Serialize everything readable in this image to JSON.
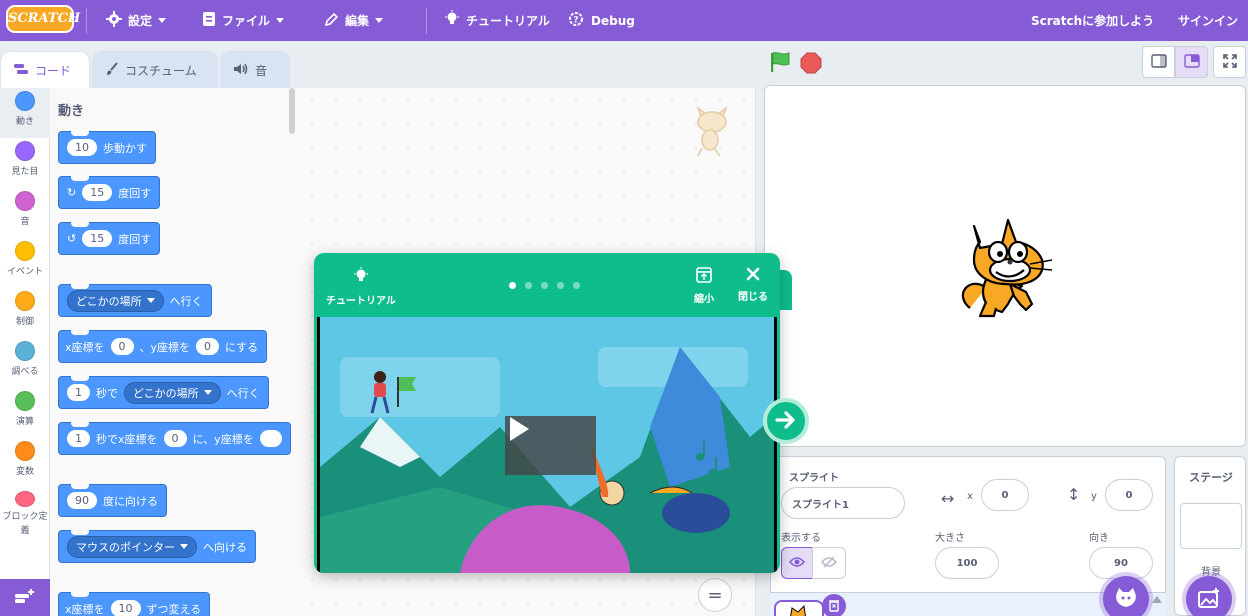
{
  "menubar": {
    "logo_text": "SCRATCH",
    "settings_label": "設定",
    "file_label": "ファイル",
    "edit_label": "編集",
    "tutorials_label": "チュートリアル",
    "debug_label": "Debug",
    "join_label": "Scratchに参加しよう",
    "signin_label": "サインイン"
  },
  "tabs": [
    {
      "label": "コード",
      "icon": "code-icon",
      "active": true
    },
    {
      "label": "コスチューム",
      "icon": "brush-icon",
      "active": false
    },
    {
      "label": "音",
      "icon": "speaker-icon",
      "active": false
    }
  ],
  "categories": [
    {
      "label": "動き",
      "color": "#4c97ff"
    },
    {
      "label": "見た目",
      "color": "#9966ff"
    },
    {
      "label": "音",
      "color": "#cf63cf"
    },
    {
      "label": "イベント",
      "color": "#ffbf00"
    },
    {
      "label": "制御",
      "color": "#ffab19"
    },
    {
      "label": "調べる",
      "color": "#5cb1d6"
    },
    {
      "label": "演算",
      "color": "#59c059"
    },
    {
      "label": "変数",
      "color": "#ff8c1a"
    },
    {
      "label": "ブロック定義",
      "color": "#ff6680"
    }
  ],
  "palette": {
    "heading": "動き",
    "move": {
      "value": "10",
      "text": "歩動かす"
    },
    "turn_right": {
      "value": "15",
      "text": "度回す"
    },
    "turn_left": {
      "value": "15",
      "text": "度回す"
    },
    "goto": {
      "dropdown": "どこかの場所",
      "text": "へ行く"
    },
    "goto_xy": {
      "x_label": "x座標を",
      "x_value": "0",
      "sep": "、y座標を",
      "y_value": "0",
      "suffix": "にする"
    },
    "glide_to": {
      "value": "1",
      "mid": "秒で",
      "dropdown": "どこかの場所",
      "text": "へ行く"
    },
    "glide_xy": {
      "value": "1",
      "mid": "秒でx座標を",
      "x_value": "0",
      "sep": "に、y座標を"
    },
    "point_dir": {
      "value": "90",
      "text": "度に向ける"
    },
    "point_towards": {
      "dropdown": "マウスのポインター",
      "text": "へ向ける"
    },
    "change_x": {
      "label": "x座標を",
      "value": "10",
      "text": "ずつ変える"
    }
  },
  "zoom_reset_symbol": "=",
  "tutorial": {
    "title": "チュートリアル",
    "shrink_label": "縮小",
    "close_label": "閉じる",
    "step_count": 5,
    "current_step": 1
  },
  "sprite_info": {
    "sprite_label": "スプライト",
    "sprite_name": "スプライト1",
    "x_label": "x",
    "x_value": "0",
    "y_label": "y",
    "y_value": "0",
    "show_label": "表示する",
    "size_label": "大きさ",
    "size_value": "100",
    "direction_label": "向き",
    "direction_value": "90"
  },
  "stage_pane": {
    "title": "ステージ",
    "backdrop_label": "背景"
  },
  "colors": {
    "menubar": "#855cd6",
    "motion": "#4c97ff",
    "tutorial": "#0fbd8c"
  }
}
